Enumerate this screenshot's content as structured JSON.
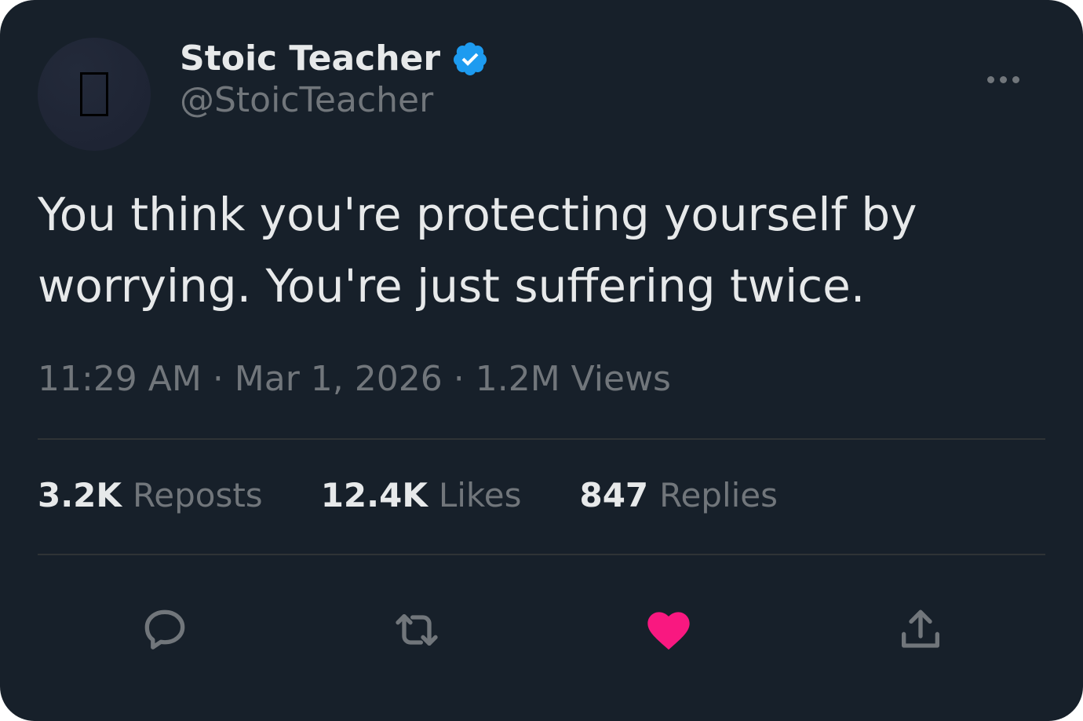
{
  "author": {
    "display_name": "Stoic Teacher",
    "handle": "@StoicTeacher",
    "verified": true,
    "avatar_icon": "avatar-placeholder-icon"
  },
  "tweet": {
    "text": "You think you're protecting yourself by\nworrying. You're just suffering twice.",
    "meta": "11:29 AM · Mar 1, 2026 · 1.2M Views"
  },
  "stats": {
    "reposts": {
      "count": "3.2K",
      "label": "Reposts"
    },
    "likes": {
      "count": "12.4K",
      "label": "Likes"
    },
    "replies": {
      "count": "847",
      "label": "Replies"
    }
  },
  "actions": {
    "reply_icon": "reply-icon",
    "repost_icon": "repost-icon",
    "like_icon": "heart-icon",
    "like_active": true,
    "share_icon": "share-icon"
  },
  "colors": {
    "background": "#17202a",
    "text_primary": "#e7e9ea",
    "text_secondary": "#71767b",
    "verified_blue": "#1d9bf0",
    "like_pink": "#f91880",
    "divider": "#2f3336"
  }
}
